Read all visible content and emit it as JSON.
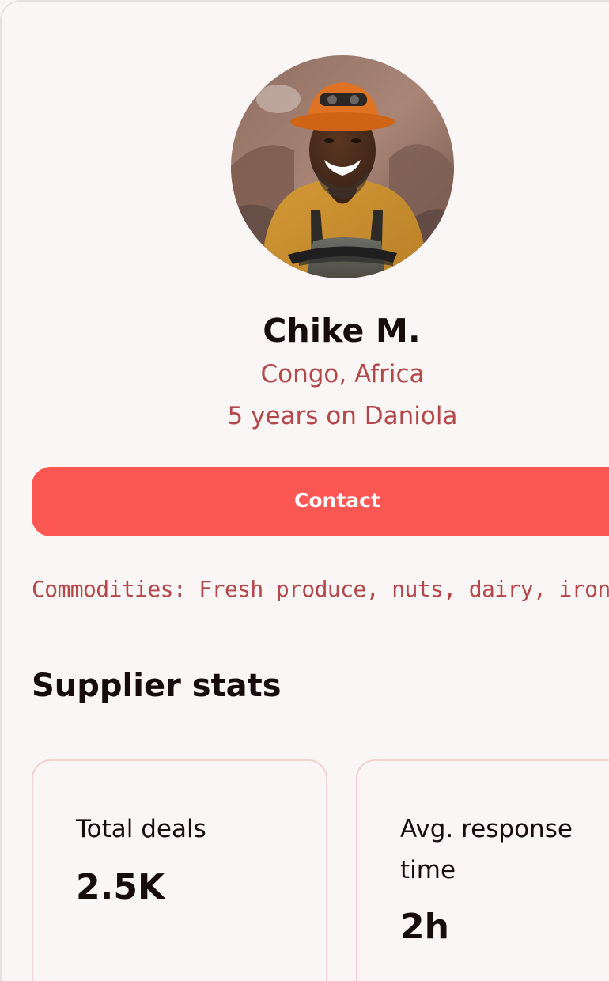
{
  "profile": {
    "name": "Chike M.",
    "location": "Congo, Africa",
    "tenure": "5 years on Daniola",
    "avatar_alt": "Supplier portrait"
  },
  "actions": {
    "contact_label": "Contact"
  },
  "commodities": {
    "text": "Commodities: Fresh produce, nuts, dairy, iron ore"
  },
  "stats": {
    "title": "Supplier stats",
    "items": [
      {
        "label": "Total deals",
        "value": "2.5K"
      },
      {
        "label": "Avg. response time",
        "value": "2h"
      }
    ]
  },
  "colors": {
    "accent": "#fd5753",
    "muted_text": "#b4474a",
    "heading": "#160c0c",
    "card_border": "#f2d2d3"
  }
}
